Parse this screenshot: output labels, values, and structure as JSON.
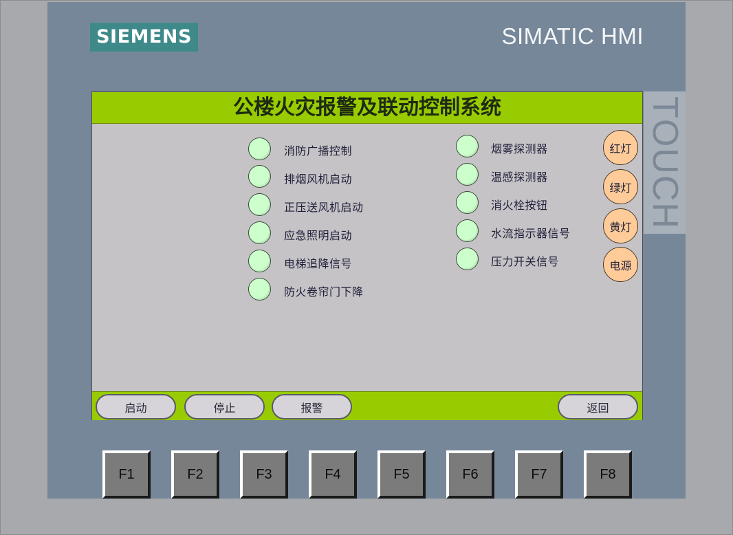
{
  "device": {
    "brand": "SIEMENS",
    "model": "SIMATIC HMI",
    "touch_label": "TOUCH"
  },
  "screen": {
    "title": "公楼火灾报警及联动控制系统",
    "left_indicators": [
      {
        "label": "消防广播控制"
      },
      {
        "label": "排烟风机启动"
      },
      {
        "label": "正压送风机启动"
      },
      {
        "label": "应急照明启动"
      },
      {
        "label": "电梯追降信号"
      },
      {
        "label": "防火卷帘门下降"
      }
    ],
    "right_indicators": [
      {
        "label": "烟雾探测器"
      },
      {
        "label": "温感探测器"
      },
      {
        "label": "消火栓按钮"
      },
      {
        "label": "水流指示器信号"
      },
      {
        "label": "压力开关信号"
      }
    ],
    "lamps": [
      {
        "label": "红灯"
      },
      {
        "label": "绿灯"
      },
      {
        "label": "黄灯"
      },
      {
        "label": "电源"
      }
    ],
    "buttons": {
      "start": "启动",
      "stop": "停止",
      "alarm": "报警",
      "back": "返回"
    }
  },
  "function_keys": [
    "F1",
    "F2",
    "F3",
    "F4",
    "F5",
    "F6",
    "F7",
    "F8"
  ],
  "colors": {
    "title_bar": "#99cc00",
    "indicator_off": "#ccffcc",
    "lamp": "#ffcc99",
    "screen_bg": "#c6c3c6",
    "panel": "#77879a",
    "logo_bg": "#3e8a8a"
  }
}
